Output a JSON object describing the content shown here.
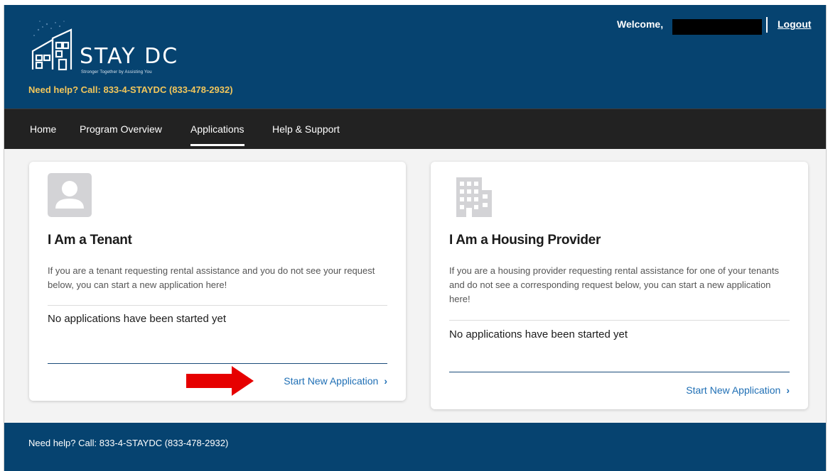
{
  "header": {
    "brand": "STAY DC",
    "tagline": "Stronger Together by Assisting You",
    "need_help": "Need help? Call: 833-4-STAYDC (833-478-2932)",
    "welcome": "Welcome,",
    "logout": "Logout"
  },
  "nav": {
    "items": [
      {
        "label": "Home"
      },
      {
        "label": "Program Overview"
      },
      {
        "label": "Applications"
      },
      {
        "label": "Help & Support"
      }
    ],
    "active": "Applications"
  },
  "tenant_card": {
    "icon": "user-avatar-icon",
    "title": "I Am a Tenant",
    "description": "If you are a tenant requesting rental assistance and you do not see your request below, you can start a new application here!",
    "empty_text": "No applications have been started yet",
    "action": "Start New Application"
  },
  "provider_card": {
    "icon": "building-icon",
    "title": "I Am a Housing Provider",
    "description": "If you are a housing provider requesting rental assistance for one of your tenants and do not see a corresponding request below, you can start a new application here!",
    "empty_text": "No applications have been started yet",
    "action": "Start New Application"
  },
  "footer": {
    "need_help": "Need help? Call: 833-4-STAYDC (833-478-2932)"
  },
  "colors": {
    "header_bg": "#064370",
    "nav_bg": "#222222",
    "help_text": "#f2c65b",
    "link": "#1f6fb5",
    "arrow": "#e60000"
  }
}
